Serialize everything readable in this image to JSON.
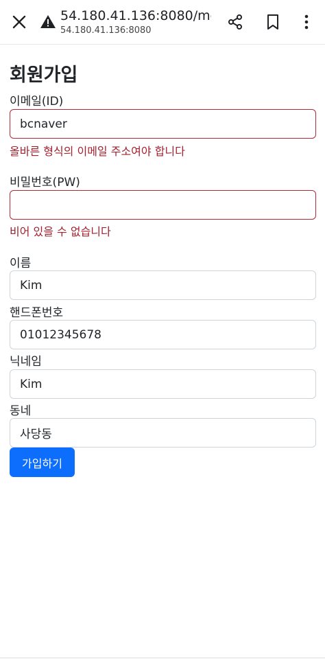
{
  "browser": {
    "url_main": "54.180.41.136:8080/me...",
    "url_sub": "54.180.41.136:8080"
  },
  "page": {
    "title": "회원가입"
  },
  "form": {
    "email": {
      "label": "이메일(ID)",
      "value": "bcnaver",
      "error": "올바른 형식의 이메일 주소여야 합니다"
    },
    "password": {
      "label": "비밀번호(PW)",
      "value": "",
      "error": "비어 있을 수 없습니다"
    },
    "name": {
      "label": "이름",
      "value": "Kim"
    },
    "phone": {
      "label": "핸드폰번호",
      "value": "01012345678"
    },
    "nickname": {
      "label": "닉네임",
      "value": "Kim"
    },
    "town": {
      "label": "동네",
      "value": "사당동"
    },
    "submit_label": "가입하기"
  },
  "colors": {
    "primary": "#0d6efd",
    "error": "#a3202e"
  }
}
